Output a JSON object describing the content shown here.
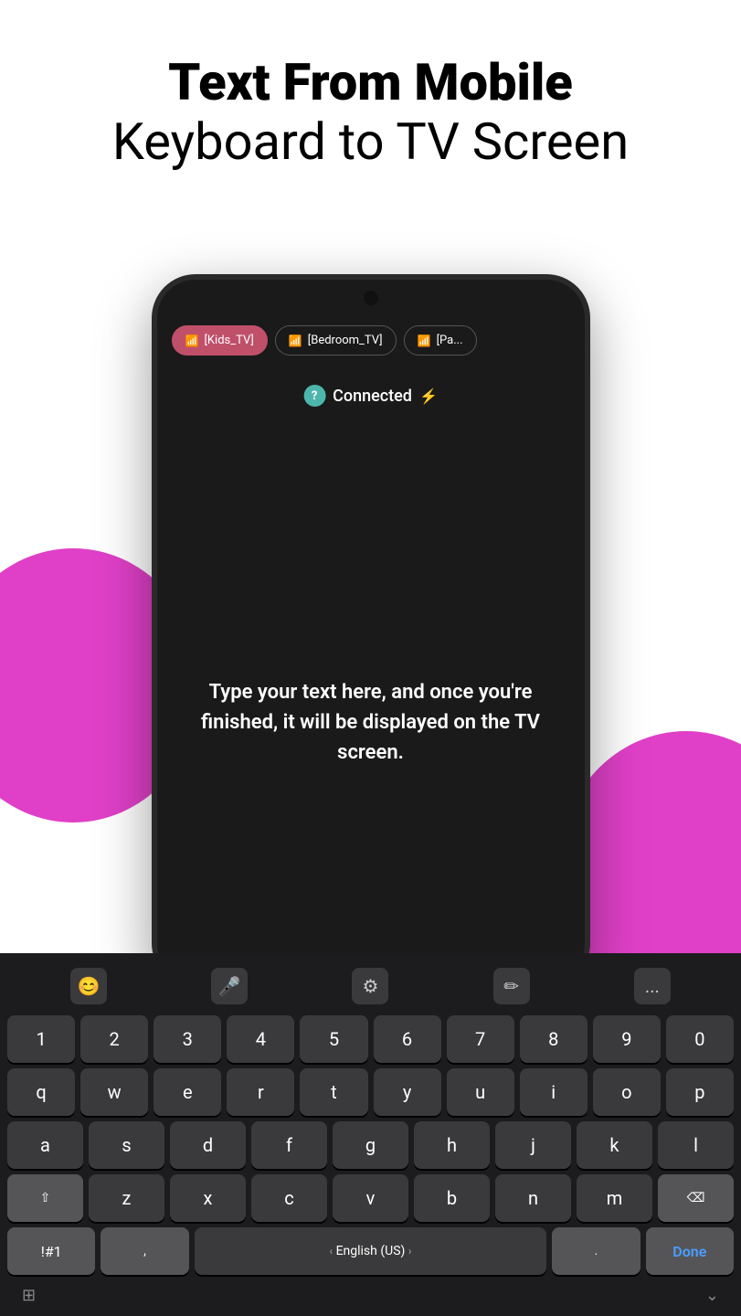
{
  "header": {
    "title_bold": "Text From Mobile",
    "title_regular": "Keyboard to TV Screen"
  },
  "phone": {
    "chips": [
      {
        "label": "[Kids_TV]",
        "active": true
      },
      {
        "label": "[Bedroom_TV]",
        "active": false
      },
      {
        "label": "[Pa...",
        "active": false
      }
    ],
    "status": {
      "text": "Connected",
      "icon": "?"
    },
    "body_text": "Type your text here, and once you're finished, it will be displayed on the TV screen."
  },
  "keyboard": {
    "toolbar": {
      "emoji_label": "😊",
      "mic_label": "🎤",
      "settings_label": "⚙",
      "text_label": "✏",
      "more_label": "..."
    },
    "rows": {
      "numbers": [
        "1",
        "2",
        "3",
        "4",
        "5",
        "6",
        "7",
        "8",
        "9",
        "0"
      ],
      "row1": [
        "q",
        "w",
        "e",
        "r",
        "t",
        "y",
        "u",
        "i",
        "o",
        "p"
      ],
      "row2": [
        "a",
        "s",
        "d",
        "f",
        "g",
        "h",
        "j",
        "k",
        "l"
      ],
      "row3": [
        "z",
        "x",
        "c",
        "v",
        "b",
        "n",
        "m"
      ],
      "bottom": {
        "symbols": "!#1",
        "comma": ",",
        "space": "English (US)",
        "period": ".",
        "done": "Done"
      }
    },
    "bottom_bar": {
      "grid": "⊞",
      "collapse": "⌄"
    }
  }
}
